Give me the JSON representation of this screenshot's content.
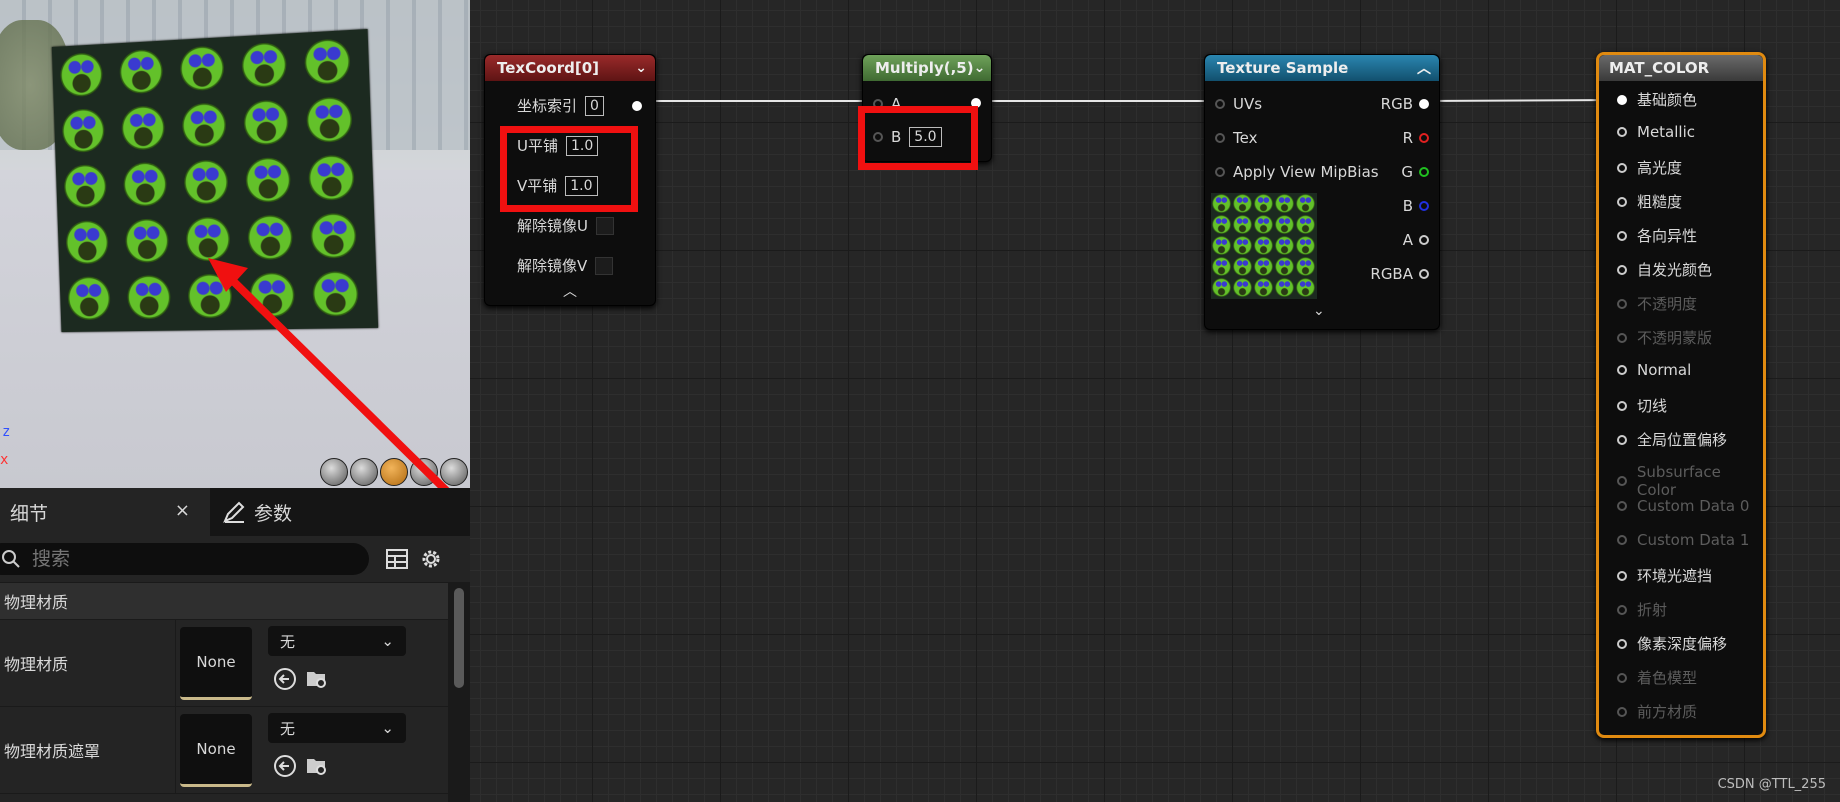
{
  "viewport": {
    "axis_z": "z",
    "axis_x": "x",
    "view_buttons": [
      "cylinder",
      "sphere",
      "plane",
      "cube",
      "teapot"
    ],
    "active_view_button": "plane"
  },
  "details_panel": {
    "tab_details": "细节",
    "tab_close": "×",
    "tab_params": "参数",
    "search_placeholder": "搜索",
    "section": "物理材质",
    "rows": [
      {
        "label": "物理材质",
        "thumb": "None",
        "dropdown": "无"
      },
      {
        "label": "物理材质遮罩",
        "thumb": "None",
        "dropdown": "无"
      }
    ]
  },
  "nodes": {
    "texcoord": {
      "title": "TexCoord[0]",
      "title_color": "#7a1e1e",
      "coord_index_label": "坐标索引",
      "coord_index_value": "0",
      "u_tiling_label": "U平铺",
      "u_tiling_value": "1.0",
      "v_tiling_label": "V平铺",
      "v_tiling_value": "1.0",
      "unmirror_u_label": "解除镜像U",
      "unmirror_v_label": "解除镜像V"
    },
    "multiply": {
      "title": "Multiply(,5)",
      "title_color": "#5b8a4a",
      "input_a": "A",
      "input_b": "B",
      "b_value": "5.0"
    },
    "texture_sample": {
      "title": "Texture Sample",
      "title_color": "#1d6a8f",
      "inputs": [
        "UVs",
        "Tex",
        "Apply View MipBias"
      ],
      "outputs": [
        {
          "label": "RGB",
          "color": "#ffffff"
        },
        {
          "label": "R",
          "color": "#e02020"
        },
        {
          "label": "G",
          "color": "#20c020"
        },
        {
          "label": "B",
          "color": "#2030e0"
        },
        {
          "label": "A",
          "color": "#bbbbbb"
        },
        {
          "label": "RGBA",
          "color": "#bbbbbb"
        }
      ]
    },
    "mat_color": {
      "title": "MAT_COLOR",
      "border_color": "#e08a10",
      "pins": [
        {
          "label": "基础颜色",
          "enabled": true
        },
        {
          "label": "Metallic",
          "enabled": true
        },
        {
          "label": "高光度",
          "enabled": true
        },
        {
          "label": "粗糙度",
          "enabled": true
        },
        {
          "label": "各向异性",
          "enabled": true
        },
        {
          "label": "自发光颜色",
          "enabled": true
        },
        {
          "label": "不透明度",
          "enabled": false
        },
        {
          "label": "不透明蒙版",
          "enabled": false
        },
        {
          "label": "Normal",
          "enabled": true
        },
        {
          "label": "切线",
          "enabled": true
        },
        {
          "label": "全局位置偏移",
          "enabled": true
        },
        {
          "label": "Subsurface Color",
          "enabled": false
        },
        {
          "label": "Custom Data 0",
          "enabled": false
        },
        {
          "label": "Custom Data 1",
          "enabled": false
        },
        {
          "label": "环境光遮挡",
          "enabled": true
        },
        {
          "label": "折射",
          "enabled": false
        },
        {
          "label": "像素深度偏移",
          "enabled": true
        },
        {
          "label": "着色模型",
          "enabled": false
        },
        {
          "label": "前方材质",
          "enabled": false
        }
      ]
    }
  },
  "annotation_color": "#f01010",
  "watermark": "CSDN @TTL_255"
}
